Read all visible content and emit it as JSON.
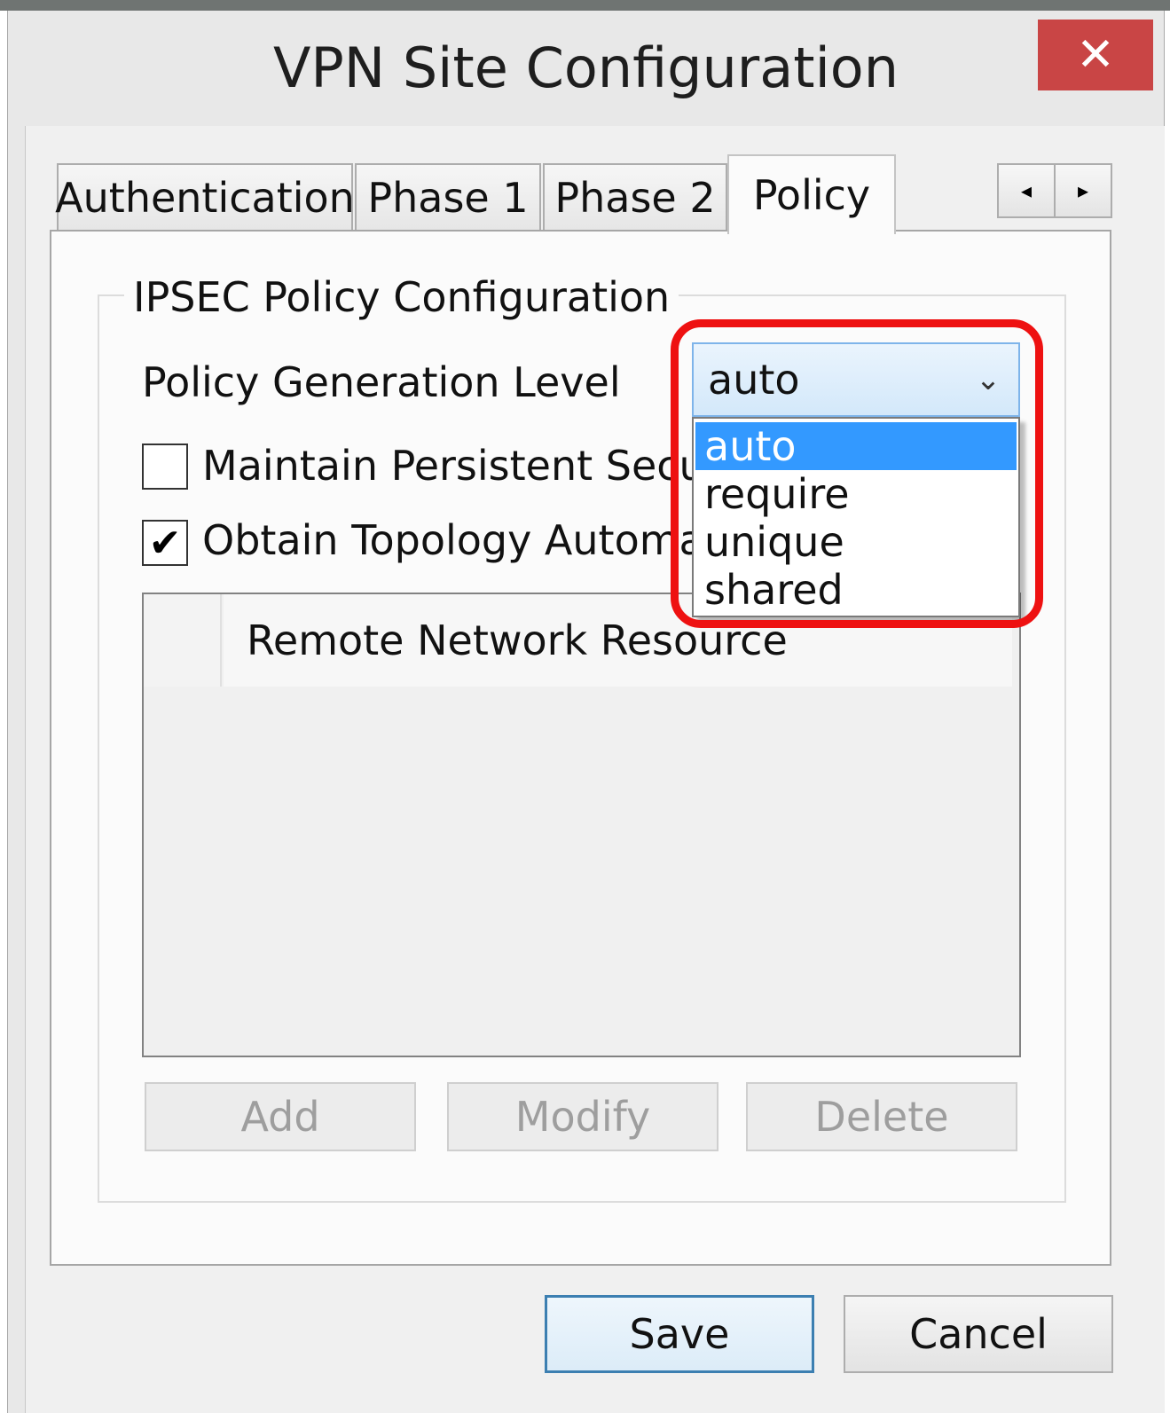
{
  "window": {
    "title": "VPN Site Configuration",
    "close_label": "✕"
  },
  "tabs": [
    {
      "label": "Authentication",
      "active": false
    },
    {
      "label": "Phase 1",
      "active": false
    },
    {
      "label": "Phase 2",
      "active": false
    },
    {
      "label": "Policy",
      "active": true
    }
  ],
  "tab_scroll": {
    "left_glyph": "◂",
    "right_glyph": "▸"
  },
  "group": {
    "title": "IPSEC Policy Configuration",
    "policy_level_label": "Policy Generation Level",
    "policy_level_value": "auto",
    "policy_level_options": [
      "auto",
      "require",
      "unique",
      "shared"
    ],
    "maintain_label": "Maintain Persistent Security",
    "maintain_checked": false,
    "obtain_label": "Obtain Topology Automatic",
    "obtain_checked": true,
    "list_header": "Remote Network Resource"
  },
  "list_buttons": {
    "add": "Add",
    "modify": "Modify",
    "delete": "Delete"
  },
  "footer": {
    "save": "Save",
    "cancel": "Cancel"
  },
  "colors": {
    "highlight": "#ee1111",
    "selection": "#3399ff",
    "close_button": "#c94545"
  },
  "icons": {
    "combo_arrow": "chevron-down-icon",
    "check": "checkmark-icon"
  }
}
